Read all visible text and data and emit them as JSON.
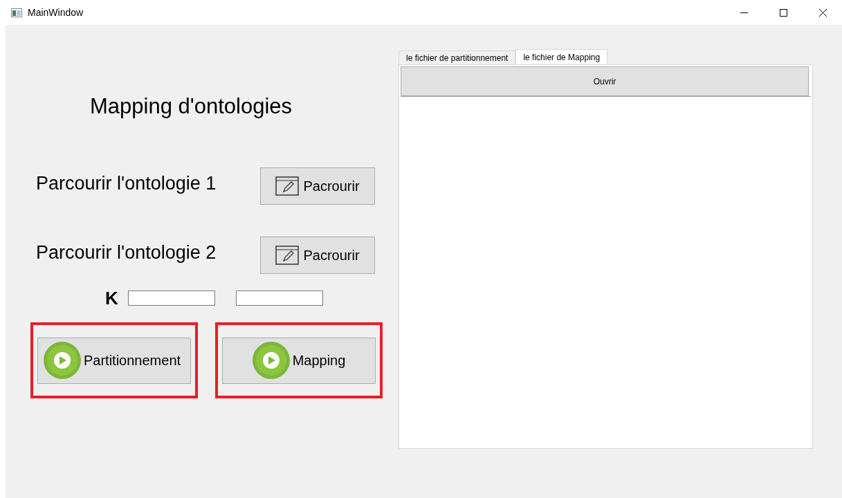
{
  "window": {
    "title": "MainWindow"
  },
  "heading": "Mapping d'ontologies",
  "browse_rows": [
    {
      "label": "Parcourir l'ontologie 1",
      "button": "Pacrourir"
    },
    {
      "label": "Parcourir l'ontologie 2",
      "button": "Pacrourir"
    }
  ],
  "k_label": "K",
  "actions": [
    {
      "label": "Partitionnement",
      "highlighted": true
    },
    {
      "label": "Mapping",
      "highlighted": true
    }
  ],
  "tabs": [
    {
      "label": "le fichier de partitionnement",
      "selected": false
    },
    {
      "label": "le fichier de Mapping",
      "selected": true
    }
  ],
  "open_button": "Ouvrir"
}
